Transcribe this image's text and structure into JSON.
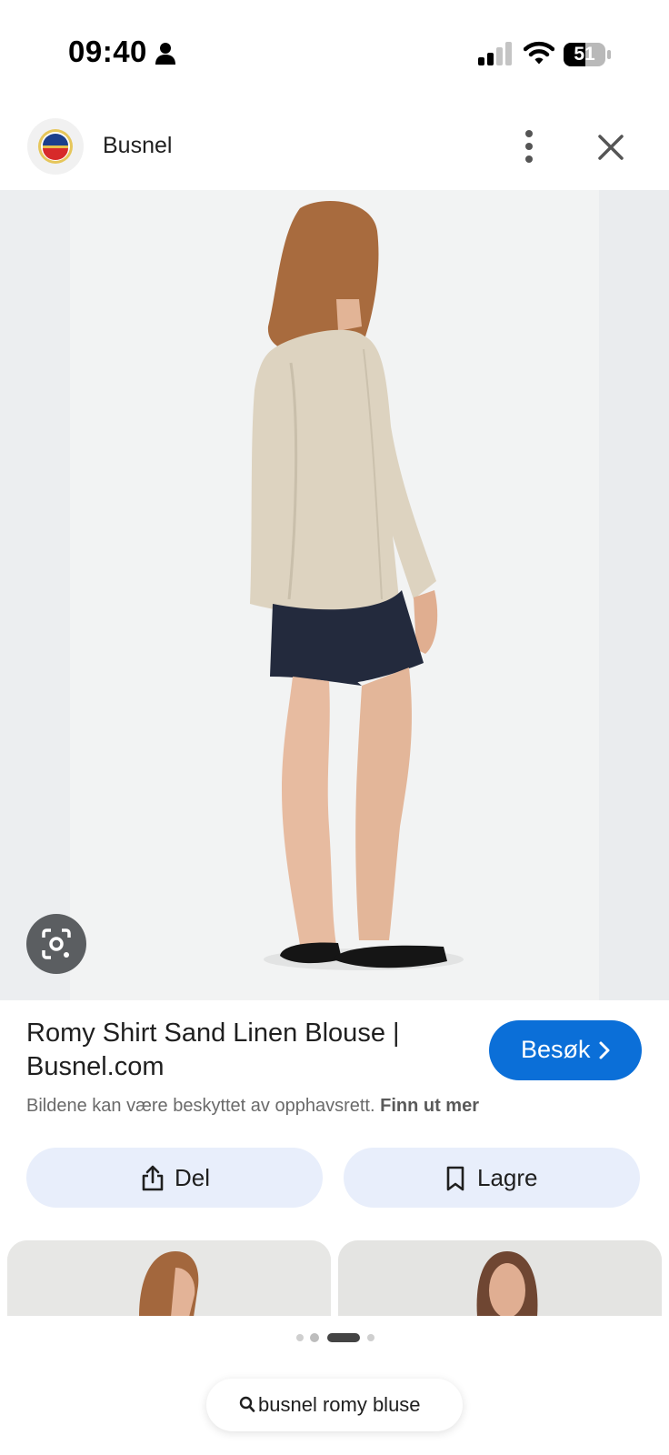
{
  "status_bar": {
    "time": "09:40",
    "battery": "51",
    "icons": [
      "person-icon",
      "signal-icon",
      "wifi-icon",
      "battery-icon"
    ]
  },
  "header": {
    "site_name": "Busnel",
    "icons": [
      "busnel-logo",
      "more-vert-icon",
      "close-icon"
    ]
  },
  "result": {
    "title": "Romy Shirt Sand Linen Blouse | Busnel.com",
    "visit_label": "Besøk",
    "copyright_text": "Bildene kan være beskyttet av opphavsrett.",
    "learn_more": "Finn ut mer"
  },
  "actions": {
    "share_label": "Del",
    "save_label": "Lagre"
  },
  "pagination": {
    "count": 4,
    "active": 3
  },
  "search": {
    "query": "busnel romy bluse"
  },
  "colors": {
    "visit_button": "#0b6fd8",
    "action_button_bg": "#e8eefb",
    "lens_button": "#5b5e61"
  }
}
